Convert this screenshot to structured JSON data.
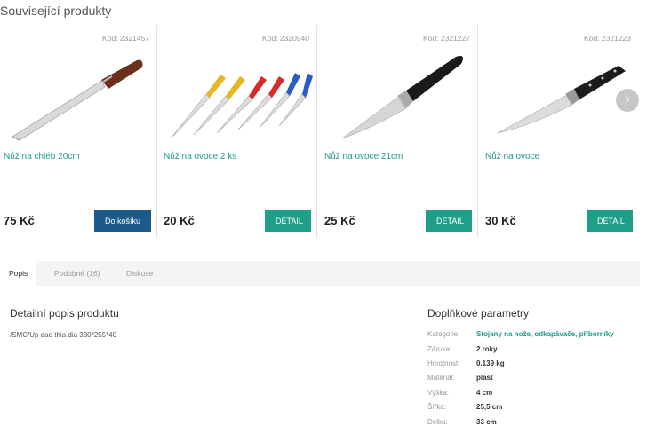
{
  "related": {
    "title": "Související produkty",
    "products": [
      {
        "code": "Kód: 2321457",
        "name": "Nůž na chléb 20cm",
        "price": "75 Kč",
        "button": "Do košíku"
      },
      {
        "code": "Kód: 2320940",
        "name": "Nůž na ovoce 2 ks",
        "price": "20 Kč",
        "button": "DETAIL"
      },
      {
        "code": "Kód: 2321227",
        "name": "Nůž na ovoce 21cm",
        "price": "25 Kč",
        "button": "DETAIL"
      },
      {
        "code": "Kód: 2321223",
        "name": "Nůž na ovoce",
        "price": "30 Kč",
        "button": "DETAIL"
      }
    ],
    "next_icon": "chevron-right-icon"
  },
  "tabs": [
    {
      "label": "Popis"
    },
    {
      "label": "Podobné (16)"
    },
    {
      "label": "Diskuse"
    }
  ],
  "description": {
    "title": "Detailní popis produktu",
    "text": "/SMC/Up dao thia dia 330*255*40"
  },
  "params": {
    "title": "Doplňkové parametry",
    "rows": [
      {
        "label": "Kategorie:",
        "value": "Stojany na nože, odkapávače, příborníky"
      },
      {
        "label": "Záruka:",
        "value": "2 roky"
      },
      {
        "label": "Hmotnost:",
        "value": "0.139 kg"
      },
      {
        "label": "Materiál:",
        "value": "plast"
      },
      {
        "label": "Výška:",
        "value": "4 cm"
      },
      {
        "label": "Šířka:",
        "value": "25,5 cm"
      },
      {
        "label": "Délka:",
        "value": "33 cm"
      }
    ]
  },
  "colors": {
    "accent": "#1f9e8a",
    "cart": "#1c5a8a",
    "link": "#1a9c8c"
  }
}
